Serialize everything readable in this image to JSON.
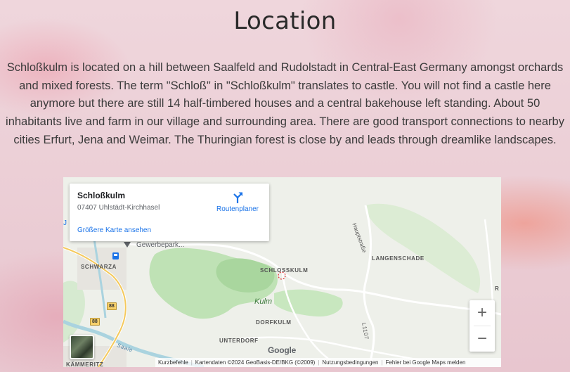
{
  "section": {
    "title": "Location",
    "intro_lines": [
      "Schloßkulm is located on a hill between Saalfeld and Rudolstadt in Central-East Germany amongst orchards",
      "and mixed forests. The term \"Schloß\" in \"Schloßkulm\" translates to castle. You will not find a castle here",
      "anymore but there are still 14 half-timbered houses and a central bakehouse left standing. About 50",
      "inhabitants live and farm in our village and surrounding area. There are good transport connections to nearby",
      "cities Erfurt, Jena and Weimar. The Thuringian forest is close by and leads through dreamlike landscapes."
    ]
  },
  "map": {
    "info_card": {
      "title": "Schloßkulm",
      "address": "07407 Uhlstädt-Kirchhasel",
      "larger_map_link": "Größere Karte ansehen",
      "route_label": "Routenplaner"
    },
    "labels": {
      "gewerbepark": "Gewerbepark...",
      "schwarza": "SCHWARZA",
      "schlosskulm": "SCHLOSSKULM",
      "langenschade": "LANGENSCHADE",
      "kulm": "Kulm",
      "dorfkulm": "DORFKULM",
      "unterdorf": "UNTERDORF",
      "kammeritz": "KÄMMERITZ",
      "hauptstrasse": "Hauptstraße",
      "saale": "Saale",
      "l1107": "L1107",
      "road_88_a": "88",
      "road_88_b": "88",
      "edge_j": "J",
      "edge_r": "R"
    },
    "google_logo": "Google",
    "attribution": {
      "shortcuts": "Kurzbefehle",
      "map_data": "Kartendaten ©2024 GeoBasis-DE/BKG (©2009)",
      "terms": "Nutzungsbedingungen",
      "report": "Fehler bei Google Maps melden"
    },
    "zoom": {
      "in": "+",
      "out": "−"
    },
    "icons": {
      "route": "directions-arrow-icon",
      "layer": "satellite-layer-icon",
      "train": "train-station-icon",
      "pin": "place-pin-icon"
    },
    "colors": {
      "forest": "#bfe2b5",
      "forest_dark": "#a9d69e",
      "river": "#aad3df",
      "link": "#1a73e8",
      "road_badge": "#f7d06a"
    }
  }
}
